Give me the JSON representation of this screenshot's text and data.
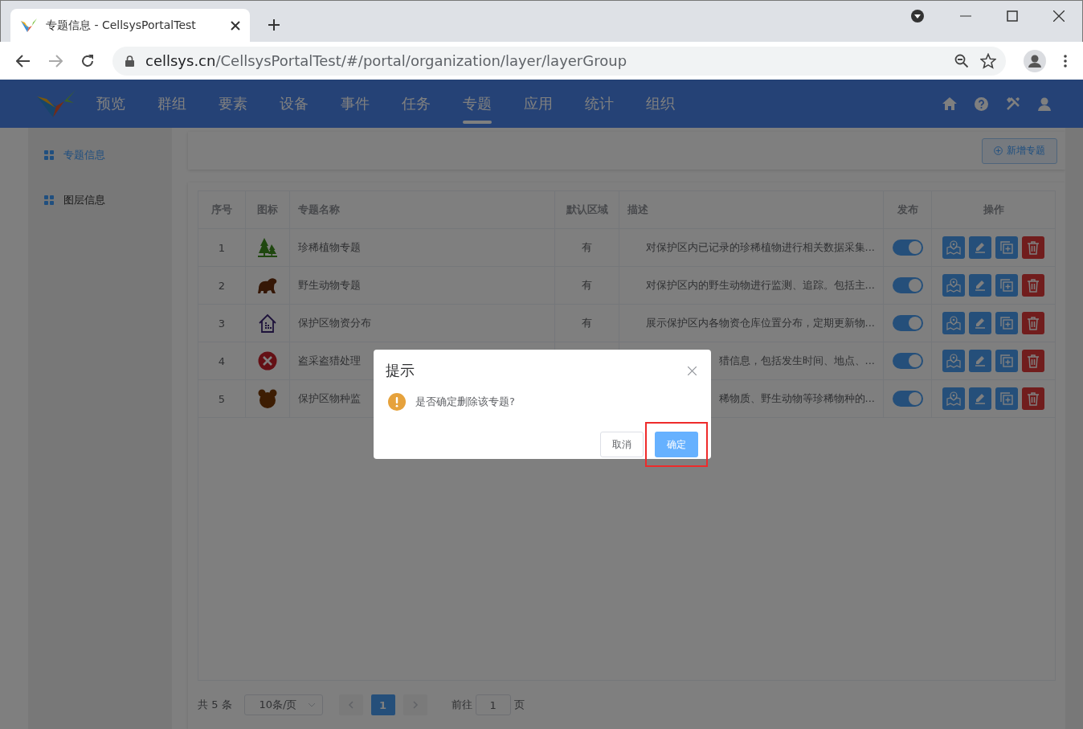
{
  "browser": {
    "tab_title": "专题信息 - CellsysPortalTest",
    "url_host": "cellsys.cn",
    "url_path": "/CellsysPortalTest/#/portal/organization/layer/layerGroup"
  },
  "nav": {
    "items": [
      {
        "label": "预览",
        "selected": false
      },
      {
        "label": "群组",
        "selected": false
      },
      {
        "label": "要素",
        "selected": false
      },
      {
        "label": "设备",
        "selected": false
      },
      {
        "label": "事件",
        "selected": false
      },
      {
        "label": "任务",
        "selected": false
      },
      {
        "label": "专题",
        "selected": true
      },
      {
        "label": "应用",
        "selected": false
      },
      {
        "label": "统计",
        "selected": false
      },
      {
        "label": "组织",
        "selected": false
      }
    ]
  },
  "sidebar": {
    "items": [
      {
        "label": "专题信息",
        "selected": true
      },
      {
        "label": "图层信息",
        "selected": false
      }
    ]
  },
  "toolbar": {
    "add_button": "新增专题"
  },
  "table": {
    "columns": [
      "序号",
      "图标",
      "专题名称",
      "默认区域",
      "描述",
      "发布",
      "操作"
    ],
    "rows": [
      {
        "index": "1",
        "kind": "tree",
        "name": "珍稀植物专题",
        "region": "有",
        "description": "对保护区内已记录的珍稀植物进行相关数据采集...",
        "published": true
      },
      {
        "index": "2",
        "kind": "animal",
        "name": "野生动物专题",
        "region": "有",
        "description": "对保护区内的野生动物进行监测、追踪。包括主...",
        "published": true
      },
      {
        "index": "3",
        "kind": "house",
        "name": "保护区物资分布",
        "region": "有",
        "description": "展示保护区内各物资仓库位置分布，定期更新物...",
        "published": true
      },
      {
        "index": "4",
        "kind": "cross",
        "name": "盗采盗猎处理",
        "description": "猎信息，包括发生时间、地点、...",
        "published": true
      },
      {
        "index": "5",
        "kind": "bear",
        "name": "保护区物种监",
        "description": "稀物质、野生动物等珍稀物种的...",
        "published": true
      }
    ]
  },
  "pagination": {
    "total": "共 5 条",
    "page_size": "10条/页",
    "pages": [
      {
        "label": "1",
        "selected": true
      }
    ],
    "goto_label": "前往",
    "goto_value": "1",
    "goto_suffix": "页"
  },
  "dialog": {
    "title": "提示",
    "message": "是否确定删除该专题?",
    "cancel": "取消",
    "confirm": "确定",
    "highlight_confirm": true
  }
}
